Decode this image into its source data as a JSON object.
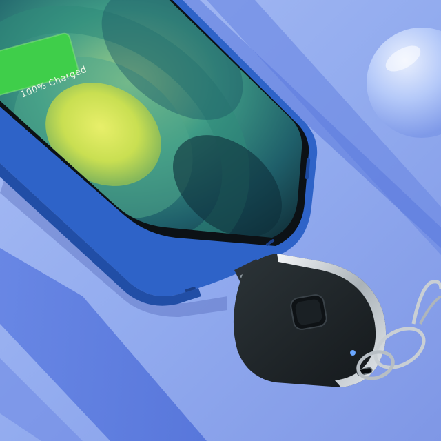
{
  "photo": {
    "subject": "keychain-power-bank-charging-phone",
    "background_color": "#8fa8ee",
    "phone_frame_color": "#2f63c9",
    "screen_accent_color": "#d8e85a",
    "battery_color": "#3fce4a",
    "charger_color": "#22282c"
  },
  "screen": {
    "charge_status": "100% Charged"
  },
  "icons": {
    "battery": "battery-full-icon",
    "power_button": "power-button-icon",
    "led": "status-led-icon"
  }
}
